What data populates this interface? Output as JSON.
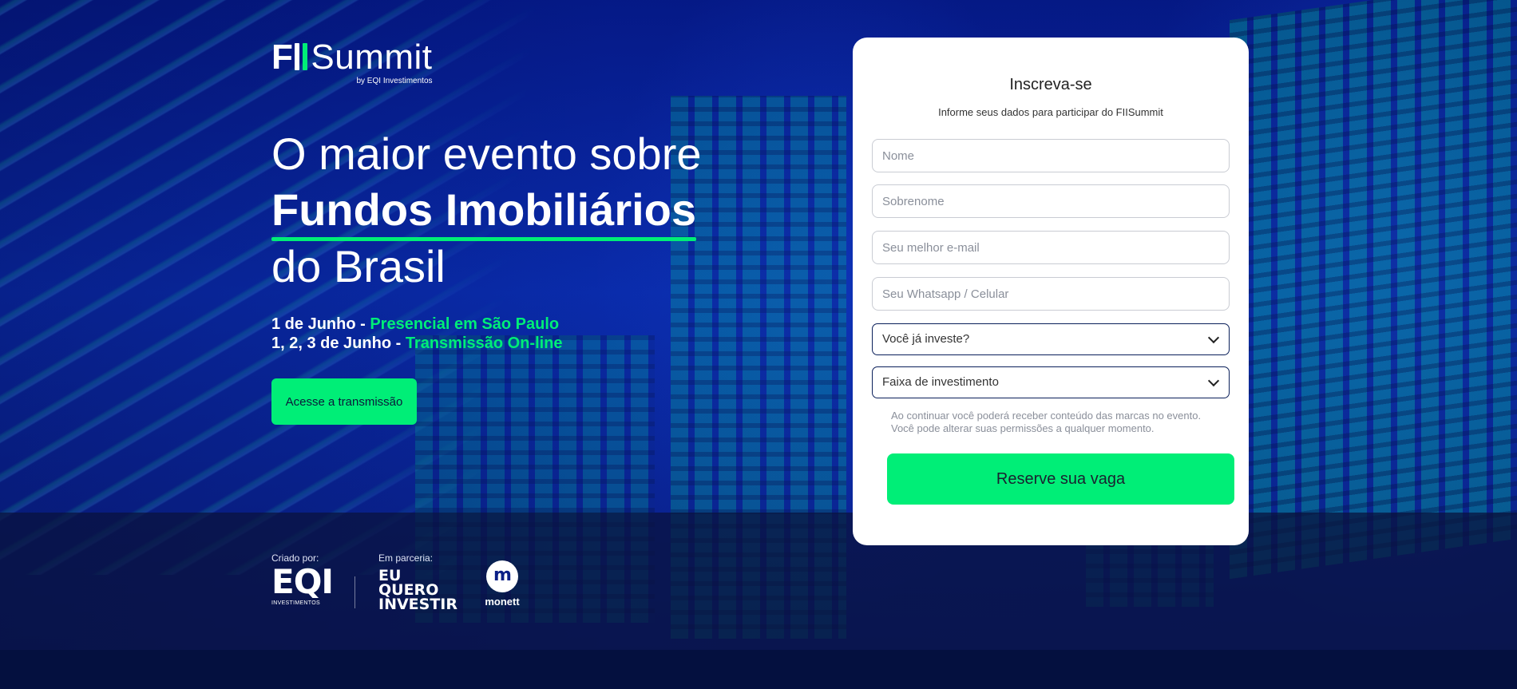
{
  "brand": {
    "logo_text": "FIISummit",
    "byline": "by EQI Investimentos",
    "accent": "#00ee77",
    "navy": "#0a1f86"
  },
  "hero": {
    "line1": "O maior evento sobre",
    "line2": "Fundos Imobiliários",
    "line3": "do Brasil",
    "dates": [
      {
        "prefix": "1 de Junho - ",
        "highlight": "Presencial em São Paulo"
      },
      {
        "prefix": "1, 2, 3 de Junho - ",
        "highlight": "Transmissão On-line"
      }
    ],
    "cta_label": "Acesse a transmissão"
  },
  "partners": {
    "created_label": "Criado por:",
    "partner_label": "Em parceria:",
    "eqi_mark": "EQI",
    "eqi_small": "INVESTIMENTOS",
    "euq_lines": [
      "EU",
      "QUERO",
      "INVESTIR"
    ],
    "monett_glyph": "m",
    "monett_name": "monett"
  },
  "form": {
    "title": "Inscreva-se",
    "subtitle": "Informe seus dados para participar do FIISummit",
    "fields": {
      "first_name": "Nome",
      "last_name": "Sobrenome",
      "email": "Seu melhor e-mail",
      "phone": "Seu Whatsapp / Celular"
    },
    "selects": {
      "invests": "Você já investe?",
      "range": "Faixa de investimento"
    },
    "consent_line1": "Ao continuar você poderá receber conteúdo das marcas no evento.",
    "consent_line2": "Você pode alterar suas permissões a qualquer momento.",
    "submit_label": "Reserve sua vaga"
  }
}
